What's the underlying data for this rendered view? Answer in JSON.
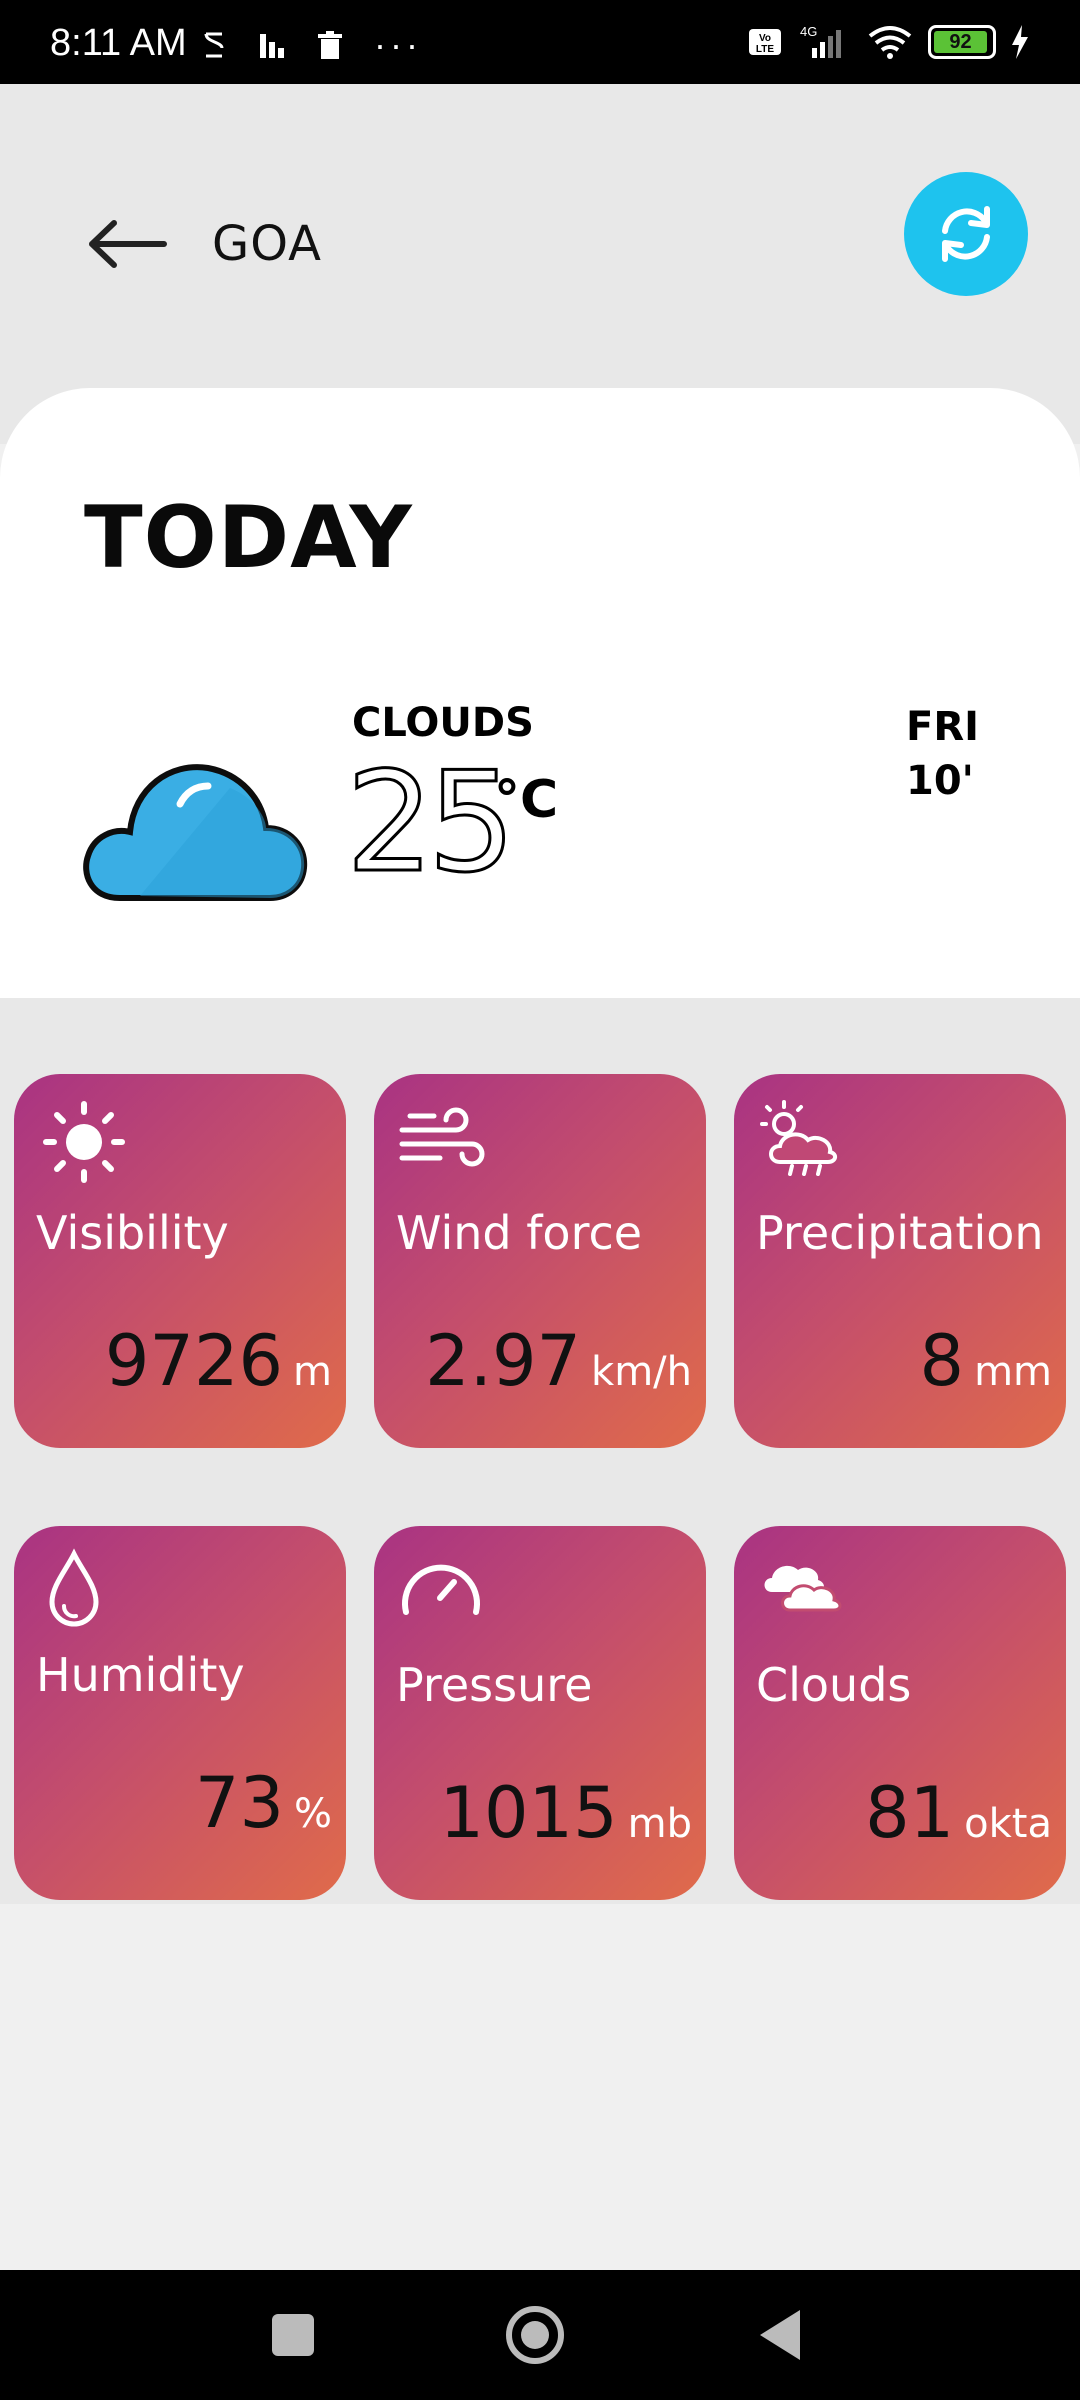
{
  "status_bar": {
    "time": "8:11 AM",
    "more": "···",
    "network": "4G",
    "volte": "Vo LTE",
    "battery": "92"
  },
  "header": {
    "city": "GOA",
    "back_icon": "arrow-left-icon",
    "refresh_icon": "refresh-icon",
    "refresh_color": "#1ec3ee"
  },
  "today": {
    "title": "TODAY",
    "condition": "CLOUDS",
    "temperature": "25",
    "unit": "°C",
    "day": "FRI",
    "time": "10'"
  },
  "metrics": [
    {
      "label": "Visibility",
      "value": "9726",
      "unit": "m",
      "icon": "sun-icon"
    },
    {
      "label": "Wind force",
      "value": "2.97",
      "unit": "km/h",
      "icon": "wind-icon"
    },
    {
      "label": "Precipitation",
      "value": "8",
      "unit": "mm",
      "icon": "rain-cloud-icon"
    },
    {
      "label": "Humidity",
      "value": "73",
      "unit": "%",
      "icon": "droplet-icon"
    },
    {
      "label": "Pressure",
      "value": "1015",
      "unit": "mb",
      "icon": "gauge-icon"
    },
    {
      "label": "Clouds",
      "value": "81",
      "unit": "okta",
      "icon": "cloud-icon"
    }
  ],
  "colors": {
    "card_gradient_start": "#a93383",
    "card_gradient_end": "#e06b4a",
    "cloud_fill": "#3aaee4"
  }
}
